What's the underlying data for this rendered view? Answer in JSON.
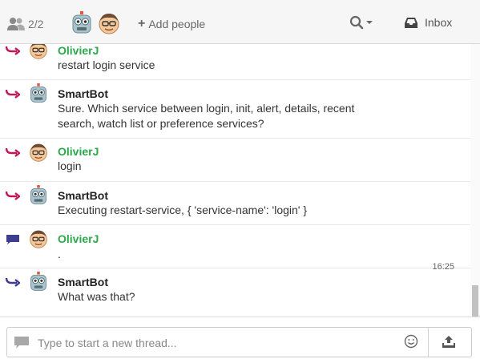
{
  "header": {
    "people_count": "2/2",
    "add_people_label": "Add people",
    "inbox_label": "Inbox"
  },
  "messages": [
    {
      "author": "OlivierJ",
      "kind": "user",
      "text": "restart login service",
      "icon": "reply-arrow-icon",
      "time": ""
    },
    {
      "author": "SmartBot",
      "kind": "bot",
      "text": "Sure. Which service between login, init, alert, details, recent search, watch list or preference services?",
      "icon": "reply-arrow-icon",
      "time": ""
    },
    {
      "author": "OlivierJ",
      "kind": "user",
      "text": "login",
      "icon": "reply-arrow-icon",
      "time": ""
    },
    {
      "author": "SmartBot",
      "kind": "bot",
      "text": "Executing restart-service, { 'service-name': 'login' }",
      "icon": "reply-arrow-icon",
      "time": ""
    },
    {
      "author": "OlivierJ",
      "kind": "user",
      "text": ".",
      "icon": "chat-bubble-icon",
      "time": "16:25"
    },
    {
      "author": "SmartBot",
      "kind": "bot",
      "text": "What was that?",
      "icon": "reply-arrow-icon",
      "time": ""
    }
  ],
  "composer": {
    "placeholder": "Type to start a new thread..."
  },
  "colors": {
    "user_name": "#2ba84a",
    "reply_arrow": "#c2185b",
    "chat_bubble": "#3f3d8f"
  }
}
